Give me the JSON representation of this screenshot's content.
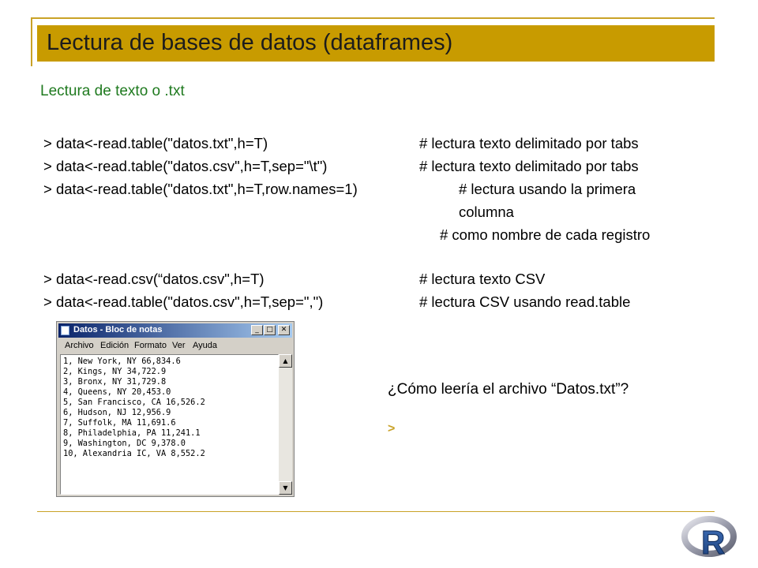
{
  "slide": {
    "title": "Lectura de bases de datos (dataframes)",
    "subtitle": "Lectura de texto o .txt",
    "code_lines": [
      {
        "cmd": "> data<-read.table(\"datos.txt\",h=T)",
        "comment": "# lectura texto delimitado por tabs"
      },
      {
        "cmd": "> data<-read.table(\"datos.csv\",h=T,sep=\"\\t\")",
        "comment": "# lectura texto delimitado por tabs"
      },
      {
        "cmd": "> data<-read.table(\"datos.txt\",h=T,row.names=1)",
        "comment": "# lectura usando la primera"
      },
      {
        "cmd": "",
        "comment": "columna"
      },
      {
        "cmd": "",
        "comment": "# como nombre de cada registro"
      },
      {
        "cmd": "> data<-read.csv(“datos.csv\",h=T)",
        "comment": "# lectura texto CSV"
      },
      {
        "cmd": "> data<-read.table(\"datos.csv\",h=T,sep=\",\")",
        "comment": "# lectura CSV usando read.table"
      }
    ],
    "question": "¿Cómo leería el archivo “Datos.txt”?",
    "prompt": ">",
    "accent_color": "#c89b00",
    "subtitle_color": "#1f7a1f"
  },
  "notepad": {
    "title": "Datos - Bloc de notas",
    "menu": [
      "Archivo",
      "Edición",
      "Formato",
      "Ver",
      "Ayuda"
    ],
    "lines": [
      "1, New York, NY 66,834.6",
      "2, Kings, NY 34,722.9",
      "3, Bronx, NY 31,729.8",
      "4, Queens, NY 20,453.0",
      "5, San Francisco, CA 16,526.2",
      "6, Hudson, NJ 12,956.9",
      "7, Suffolk, MA 11,691.6",
      "8, Philadelphia, PA 11,241.1",
      "9, Washington, DC 9,378.0",
      "10, Alexandria IC, VA 8,552.2"
    ],
    "buttons": {
      "minimize": "_",
      "maximize": "□",
      "close": "✕"
    }
  },
  "logo": {
    "letter": "R"
  }
}
